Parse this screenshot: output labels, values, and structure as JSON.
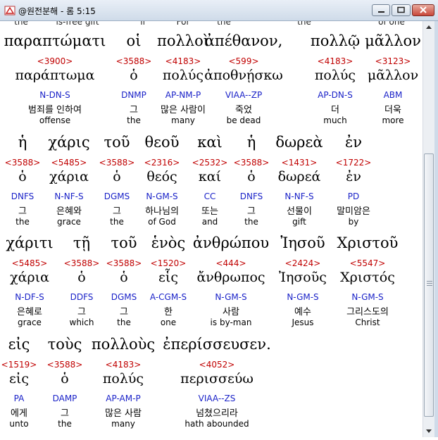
{
  "window": {
    "title": "@원전분해 - 롬 5:15",
    "minimize_label": "minimize",
    "maximize_label": "maximize",
    "close_label": "close"
  },
  "previous_line": [
    "the",
    "is-free gift",
    "if",
    "For",
    "the",
    "the",
    "of one"
  ],
  "blocks": [
    {
      "words": [
        {
          "greek": "παραπτώματι",
          "strong": "<3900>",
          "lemma": "παράπτωμα",
          "morph": "N-DN-S",
          "korean": "범죄를 인하여",
          "english": "offense"
        },
        {
          "greek": "οἱ",
          "strong": "<3588>",
          "lemma": "ὁ",
          "morph": "DNMP",
          "korean": "그",
          "english": "the"
        },
        {
          "greek": "πολλοὶ",
          "strong": "<4183>",
          "lemma": "πολύς",
          "morph": "AP-NM-P",
          "korean": "많은 사람이",
          "english": "many"
        },
        {
          "greek": "ἀπέθανον,",
          "strong": "<599>",
          "lemma": "ἀποθνῄσκω",
          "morph": "VIAA--ZP",
          "korean": "죽었",
          "english": "be dead"
        },
        {
          "greek": "πολλῷ",
          "strong": "<4183>",
          "lemma": "πολύς",
          "morph": "AP-DN-S",
          "korean": "더",
          "english": "much"
        },
        {
          "greek": "μᾶλλον",
          "strong": "<3123>",
          "lemma": "μᾶλλον",
          "morph": "ABM",
          "korean": "더욱",
          "english": "more"
        }
      ]
    },
    {
      "words": [
        {
          "greek": "ἡ",
          "strong": "<3588>",
          "lemma": "ὁ",
          "morph": "DNFS",
          "korean": "그",
          "english": "the"
        },
        {
          "greek": "χάρις",
          "strong": "<5485>",
          "lemma": "χάρια",
          "morph": "N-NF-S",
          "korean": "은혜와",
          "english": "grace"
        },
        {
          "greek": "τοῦ",
          "strong": "<3588>",
          "lemma": "ὁ",
          "morph": "DGMS",
          "korean": "그",
          "english": "the"
        },
        {
          "greek": "θεοῦ",
          "strong": "<2316>",
          "lemma": "θεός",
          "morph": "N-GM-S",
          "korean": "하나님의",
          "english": "of God"
        },
        {
          "greek": "καὶ",
          "strong": "<2532>",
          "lemma": "καί",
          "morph": "CC",
          "korean": "또는",
          "english": "and"
        },
        {
          "greek": "ἡ",
          "strong": "<3588>",
          "lemma": "ὁ",
          "morph": "DNFS",
          "korean": "그",
          "english": "the"
        },
        {
          "greek": "δωρεὰ",
          "strong": "<1431>",
          "lemma": "δωρεά",
          "morph": "N-NF-S",
          "korean": "선물이",
          "english": "gift"
        },
        {
          "greek": "ἐν",
          "strong": "<1722>",
          "lemma": "ἐν",
          "morph": "PD",
          "korean": "말미암은",
          "english": "by"
        }
      ]
    },
    {
      "words": [
        {
          "greek": "χάριτι",
          "strong": "<5485>",
          "lemma": "χάρια",
          "morph": "N-DF-S",
          "korean": "은혜로",
          "english": "grace"
        },
        {
          "greek": "τῇ",
          "strong": "<3588>",
          "lemma": "ὁ",
          "morph": "DDFS",
          "korean": "그",
          "english": "which"
        },
        {
          "greek": "τοῦ",
          "strong": "<3588>",
          "lemma": "ὁ",
          "morph": "DGMS",
          "korean": "그",
          "english": "the"
        },
        {
          "greek": "ἑνὸς",
          "strong": "<1520>",
          "lemma": "εἷς",
          "morph": "A-CGM-S",
          "korean": "한",
          "english": "one"
        },
        {
          "greek": "ἀνθρώπου",
          "strong": "<444>",
          "lemma": "ἄνθρωπος",
          "morph": "N-GM-S",
          "korean": "사람",
          "english": "is by-man"
        },
        {
          "greek": "Ἰησοῦ",
          "strong": "<2424>",
          "lemma": "Ἰησοῦς",
          "morph": "N-GM-S",
          "korean": "예수",
          "english": "Jesus"
        },
        {
          "greek": "Χριστοῦ",
          "strong": "<5547>",
          "lemma": "Χριστός",
          "morph": "N-GM-S",
          "korean": "그리스도의",
          "english": "Christ"
        }
      ]
    },
    {
      "words": [
        {
          "greek": "εἰς",
          "strong": "<1519>",
          "lemma": "εἰς",
          "morph": "PA",
          "korean": "에게",
          "english": "unto"
        },
        {
          "greek": "τοὺς",
          "strong": "<3588>",
          "lemma": "ὁ",
          "morph": "DAMP",
          "korean": "그",
          "english": "the"
        },
        {
          "greek": "πολλοὺς",
          "strong": "<4183>",
          "lemma": "πολύς",
          "morph": "AP-AM-P",
          "korean": "많은 사람",
          "english": "many"
        },
        {
          "greek": "ἐπερίσσευσεν.",
          "strong": "<4052>",
          "lemma": "περισσεύω",
          "morph": "VIAA--ZS",
          "korean": "넘쳤으리라",
          "english": "hath abounded"
        }
      ]
    }
  ]
}
